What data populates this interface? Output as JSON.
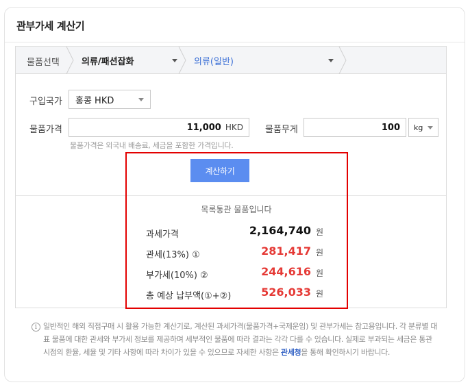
{
  "title": "관부가세 계산기",
  "breadcrumb": {
    "label": "물품선택",
    "category": "의류/패션잡화",
    "subcategory": "의류(일반)"
  },
  "form": {
    "country_label": "구입국가",
    "country_value": "홍콩 HKD",
    "price_label": "물품가격",
    "price_value": "11,000",
    "price_unit": "HKD",
    "weight_label": "물품무게",
    "weight_value": "100",
    "weight_unit": "kg",
    "price_hint": "물품가격은 외국내 배송료, 세금을 포함한 가격입니다."
  },
  "calc_button": "계산하기",
  "result": {
    "title": "목록통관 물품입니다",
    "rows": [
      {
        "label": "과세가격",
        "value": "2,164,740",
        "unit": "원"
      },
      {
        "label": "관세(13%) ①",
        "value": "281,417",
        "unit": "원"
      },
      {
        "label": "부가세(10%) ②",
        "value": "244,616",
        "unit": "원"
      },
      {
        "label": "총 예상 납부액(①+②)",
        "value": "526,033",
        "unit": "원"
      }
    ]
  },
  "note": {
    "icon": "info-icon",
    "text_before": "일반적인 해외 직접구매 시 활용 가능한 계산기로, 계산된 과세가격(물품가격+국제운임) 및 관부가세는 참고용입니다. 각 분류별 대표 물품에 대한 관세와 부가세 정보를 제공하며 세부적인 물품에 따라 결과는 각각 다를 수 있습니다. 실제로 부과되는 세금은 통관 시점의 환율, 세율 및 기타 사항에 따라 차이가 있을 수 있으므로 자세한 사항은 ",
    "link": "관세청",
    "text_after": "을 통해 확인하시기 바랍니다."
  },
  "colors": {
    "accent": "#5b8df0",
    "highlight_border": "#e30000",
    "tax_red": "#e53935",
    "link": "#2f5fc4"
  }
}
